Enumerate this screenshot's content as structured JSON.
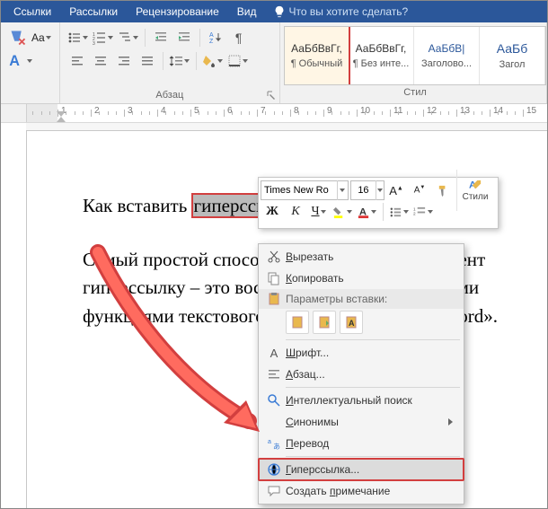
{
  "tabs": {
    "links": "Ссылки",
    "mailings": "Рассылки",
    "review": "Рецензирование",
    "view": "Вид",
    "tell": "Что вы хотите сделать?"
  },
  "ribbon": {
    "paragraph_label": "Абзац",
    "styles_label": "Стил",
    "styles": [
      {
        "prev": "АаБбВвГг,",
        "name": "¶ Обычный"
      },
      {
        "prev": "АаБбВвГг,",
        "name": "¶ Без инте..."
      },
      {
        "prev": "АаБбВ|",
        "name": "Заголово..."
      },
      {
        "prev": "АаБб",
        "name": "Загол"
      }
    ]
  },
  "ruler": {
    "numbers": [
      "1",
      "2",
      "3",
      "4",
      "5",
      "6",
      "7",
      "8",
      "9",
      "10",
      "11",
      "12",
      "13",
      "14",
      "15"
    ]
  },
  "doc": {
    "line1_pre": "Как вставить ",
    "line1_sel": "гиперссылку",
    "para2": "Самый простой способ вставить в Word-документ гиперссылку – это воспользоваться встроенными функциями текстового редактора «Microsoft Word»."
  },
  "mini": {
    "font": "Times New Ro",
    "size": "16",
    "styles_label": "Стили",
    "bold": "Ж",
    "italic": "К",
    "underline": "Ч"
  },
  "menu": {
    "cut": "Вырезать",
    "copy": "Копировать",
    "paste_header": "Параметры вставки:",
    "font": "Шрифт...",
    "paragraph": "Абзац...",
    "smart": "Интеллектуальный поиск",
    "synonyms": "Синонимы",
    "translate": "Перевод",
    "hyperlink": "Гиперссылка...",
    "comment": "Создать примечание"
  }
}
